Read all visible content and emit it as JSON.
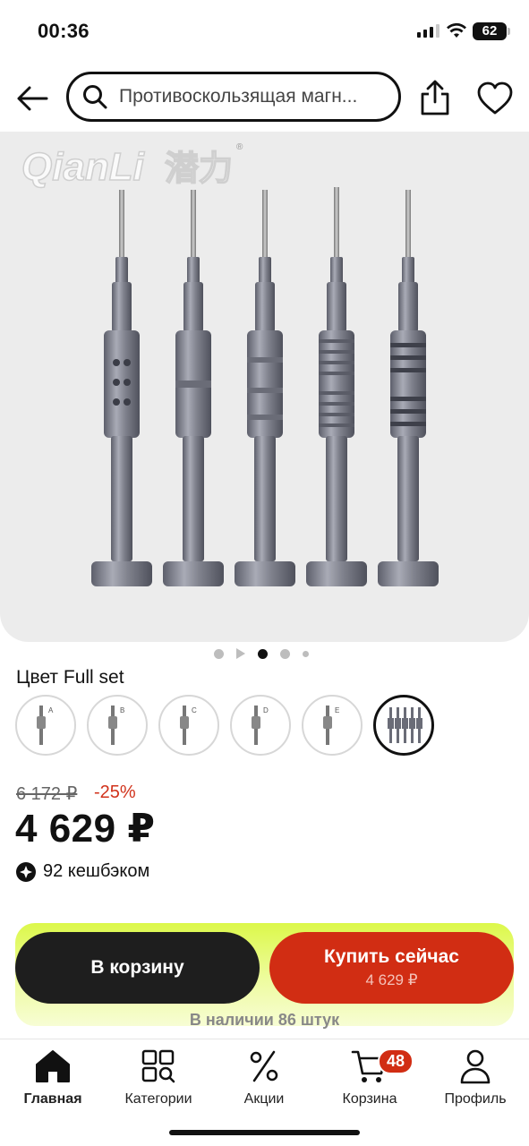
{
  "status_bar": {
    "time": "00:36",
    "battery": "62"
  },
  "header": {
    "search_text": "Противоскользящая магн..."
  },
  "image": {
    "logo_text": "QianLi",
    "logo_cn": "潜力",
    "slide_active": 3,
    "slide_count": 5
  },
  "product": {
    "color_label": "Цвет Full set",
    "swatches": [
      "A",
      "B",
      "C",
      "D",
      "E",
      "Full set"
    ],
    "old_price": "6 172 ₽",
    "discount": "-25%",
    "price": "4 629 ₽",
    "cashback": "92 кешбэком"
  },
  "buy_panel": {
    "cart_label": "В корзину",
    "buy_label": "Купить сейчас",
    "buy_price": "4 629 ₽",
    "stock": "В наличии 86 штук"
  },
  "tabbar": {
    "items": [
      {
        "label": "Главная",
        "icon": "home-icon"
      },
      {
        "label": "Категории",
        "icon": "categories-icon"
      },
      {
        "label": "Акции",
        "icon": "percent-icon"
      },
      {
        "label": "Корзина",
        "icon": "cart-icon",
        "badge": "48"
      },
      {
        "label": "Профиль",
        "icon": "profile-icon"
      }
    ]
  },
  "colors": {
    "accent_red": "#d12d13",
    "lime": "#dcf84a",
    "dark": "#1e1e1e"
  }
}
